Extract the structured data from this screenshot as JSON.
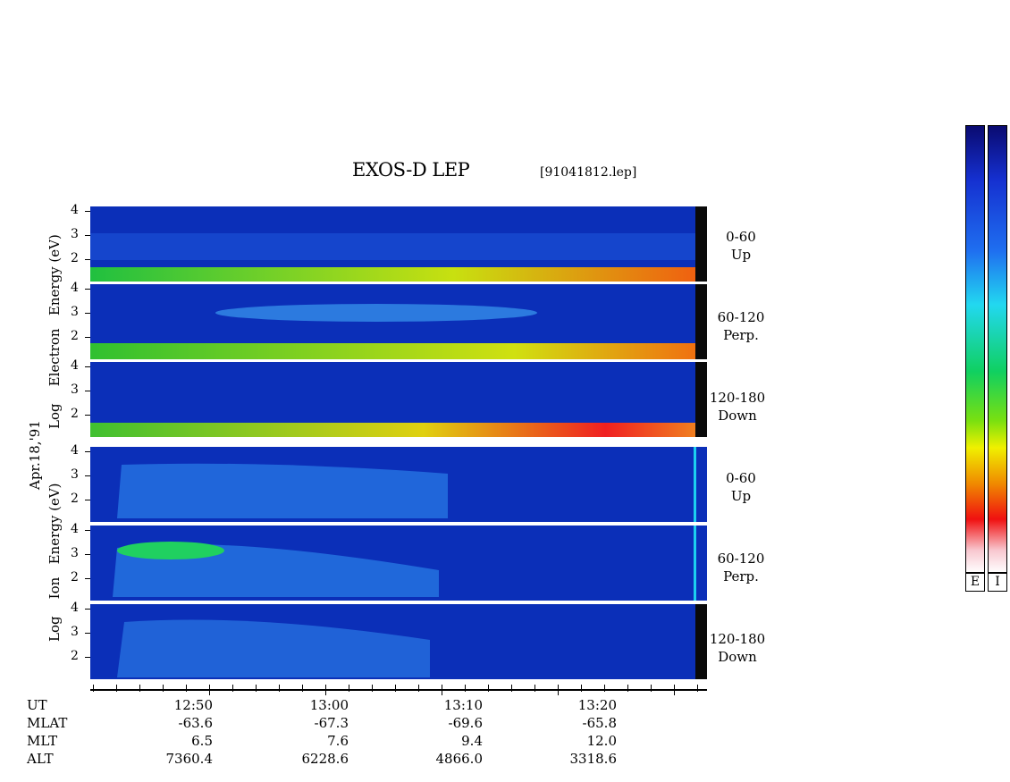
{
  "title": "EXOS-D LEP",
  "file_label": "[91041812.lep]",
  "date_label": "Apr.18,'91",
  "electron_group": {
    "word1": "Log",
    "word2": "Electron",
    "word3": "Energy",
    "word4": "(eV)"
  },
  "ion_group": {
    "word1": "Log",
    "word2": "Ion",
    "word3": "Energy",
    "word4": "(eV)"
  },
  "electron_panels": [
    {
      "range": "0-60",
      "dir": "Up"
    },
    {
      "range": "60-120",
      "dir": "Perp."
    },
    {
      "range": "120-180",
      "dir": "Down"
    }
  ],
  "ion_panels": [
    {
      "range": "0-60",
      "dir": "Up"
    },
    {
      "range": "60-120",
      "dir": "Perp."
    },
    {
      "range": "120-180",
      "dir": "Down"
    }
  ],
  "ytick_labels": [
    "4",
    "3",
    "2"
  ],
  "colorbar_labels": {
    "electron": "E",
    "ion": "I"
  },
  "rows": {
    "labels": [
      "UT",
      "MLAT",
      "MLT",
      "ALT"
    ],
    "times": [
      "12:50",
      "13:00",
      "13:10",
      "13:20"
    ],
    "mlat": [
      "-63.6",
      "-67.3",
      "-69.6",
      "-65.8"
    ],
    "mlt": [
      "6.5",
      "7.6",
      "9.4",
      "12.0"
    ],
    "alt": [
      "7360.4",
      "6228.6",
      "4866.0",
      "3318.6"
    ]
  },
  "chart_data": {
    "type": "heatmap",
    "title": "EXOS-D LEP",
    "xlabel": "UT",
    "ylabel": "Log Energy (eV)",
    "x_ticks": [
      "12:50",
      "13:00",
      "13:10",
      "13:20"
    ],
    "y_ticks": [
      2,
      3,
      4
    ],
    "ylim": [
      1,
      4.2
    ],
    "panels": [
      "Electron 0-60 Up",
      "Electron 60-120 Perp.",
      "Electron 120-180 Down",
      "Ion 0-60 Up",
      "Ion 60-120 Perp.",
      "Ion 120-180 Down"
    ],
    "colormap": [
      "#0a0a70",
      "#1530d0",
      "#1f6ff0",
      "#22d8f0",
      "#10d060",
      "#f0f000",
      "#f08a00",
      "#f01010",
      "#ffffff"
    ]
  }
}
